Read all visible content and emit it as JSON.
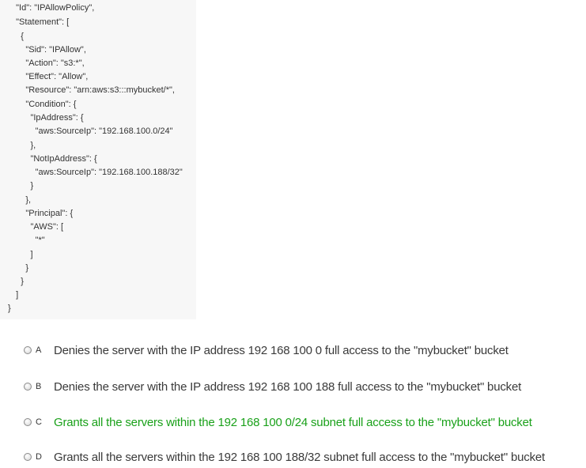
{
  "policy_code": {
    "lines": [
      "  \"Id\": \"IPAllowPolicy\",",
      "  \"Statement\": [",
      "    {",
      "      \"Sid\": \"IPAllow\",",
      "      \"Action\": \"s3:*\",",
      "      \"Effect\": \"Allow\",",
      "      \"Resource\": \"arn:aws:s3:::mybucket/*\",",
      "      \"Condition\": {",
      "        \"IpAddress\": {",
      "          \"aws:SourceIp\": \"192.168.100.0/24\"",
      "        },",
      "        \"NotIpAddress\": {",
      "          \"aws:SourceIp\": \"192.168.100.188/32\"",
      "        }",
      "      },",
      "      \"Principal\": {",
      "        \"AWS\": [",
      "          \"*\"",
      "        ]",
      "      }",
      "    }",
      "  ]",
      "}"
    ]
  },
  "options": [
    {
      "letter": "A",
      "text": "Denies the server with the IP address 192 168 100 0 full access to the \"mybucket\" bucket",
      "correct": false
    },
    {
      "letter": "B",
      "text": "Denies the server with the IP address 192 168 100 188 full access to the \"mybucket\" bucket",
      "correct": false
    },
    {
      "letter": "C",
      "text": "Grants all the servers within the 192 168 100 0/24 subnet full access to the \"mybucket\" bucket",
      "correct": true
    },
    {
      "letter": "D",
      "text": "Grants all the servers within the 192 168 100 188/32 subnet full access to the \"mybucket\" bucket",
      "correct": false
    }
  ],
  "colors": {
    "correct_answer": "#1aa11a",
    "default_text": "#3a3a3a"
  }
}
